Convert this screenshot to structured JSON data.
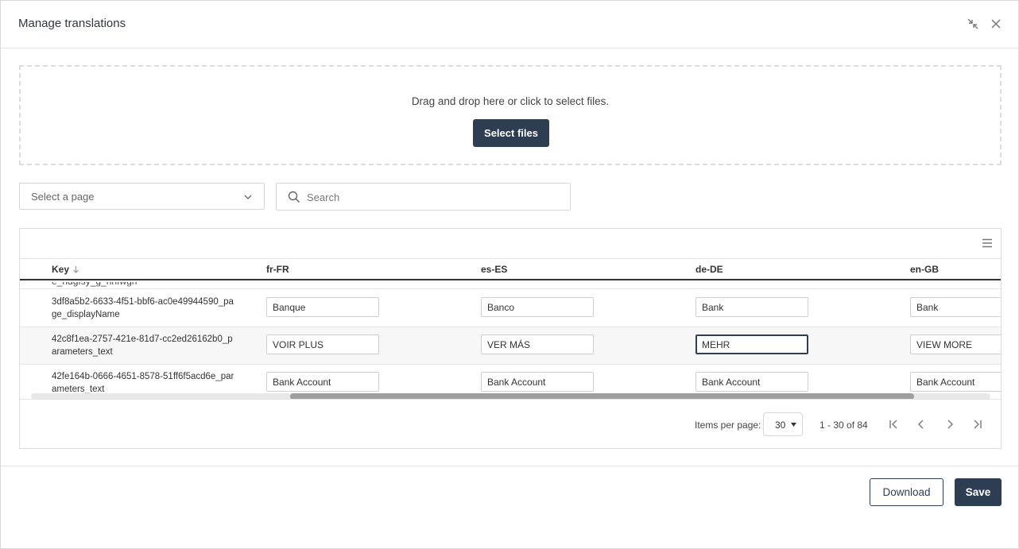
{
  "dialog": {
    "title": "Manage translations",
    "icons": {
      "collapse": "collapse-icon",
      "close": "close-icon"
    }
  },
  "dropzone": {
    "hint": "Drag and drop here or click to select files.",
    "button_label": "Select files"
  },
  "filters": {
    "page_select": {
      "placeholder": "Select a page",
      "icon": "chevron-down-icon"
    },
    "search": {
      "placeholder": "Search",
      "value": "",
      "icon": "search-icon"
    }
  },
  "grid": {
    "menu_icon": "hamburger-menu-icon",
    "columns": [
      {
        "label": "Key",
        "sort": "descending"
      },
      {
        "label": "fr-FR"
      },
      {
        "label": "es-ES"
      },
      {
        "label": "de-DE"
      },
      {
        "label": "en-GB"
      }
    ],
    "partial_row_key": "e_hdgfsy_g_nhfwgh",
    "rows": [
      {
        "key": "3df8a5b2-6633-4f51-bbf6-ac0e49944590_page_displayName",
        "fr": "Banque",
        "es": "Banco",
        "de": "Bank",
        "en": "Bank"
      },
      {
        "key": "42c8f1ea-2757-421e-81d7-cc2ed26162b0_parameters_text",
        "fr": "VOIR PLUS",
        "es": "VER MÁS",
        "de": "MEHR",
        "en": "VIEW MORE"
      },
      {
        "key": "42fe164b-0666-4651-8578-51ff6f5acd6e_parameters_text",
        "fr": "Bank Account",
        "es": "Bank Account",
        "de": "Bank Account",
        "en": "Bank Account"
      }
    ],
    "scroll_position": 0.27
  },
  "pagination": {
    "items_per_page_label": "Items per page:",
    "items_per_page": "30",
    "range": "1 - 30 of 84",
    "icons": {
      "first": "first-page-icon",
      "prev": "previous-page-icon",
      "next": "next-page-icon",
      "last": "last-page-icon"
    }
  },
  "footer": {
    "download_label": "Download",
    "save_label": "Save"
  },
  "colors": {
    "primary_button": "#2e3e52",
    "border": "#d6d6d6",
    "header_rule": "#333333"
  }
}
